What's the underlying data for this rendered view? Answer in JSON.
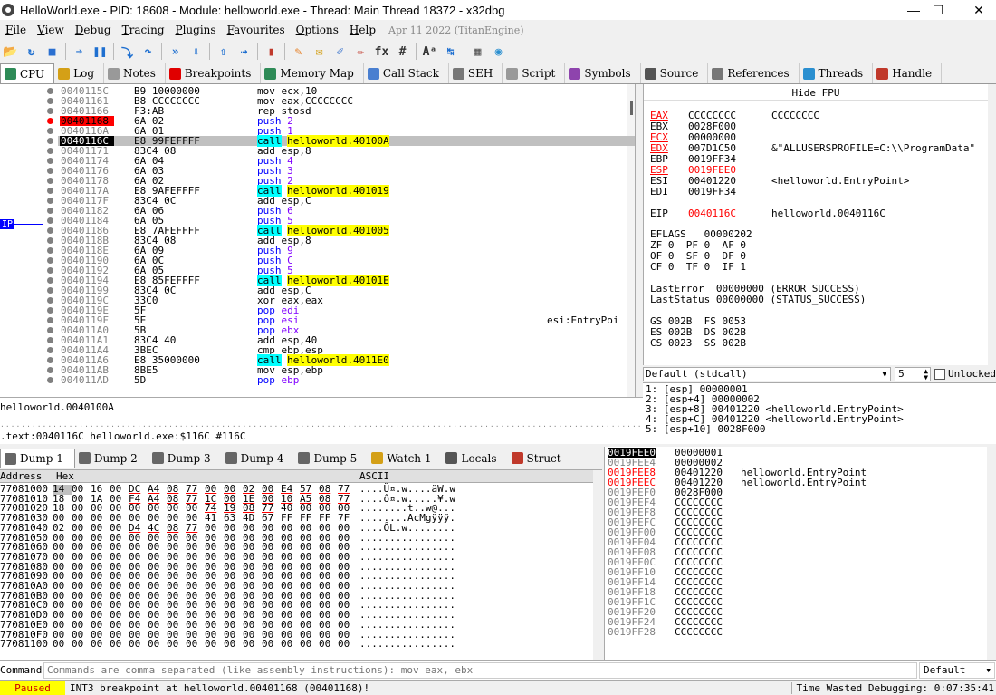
{
  "window": {
    "title": "HelloWorld.exe - PID: 18608 - Module: helloworld.exe - Thread: Main Thread 18372 - x32dbg",
    "minimize": "—",
    "maximize": "☐",
    "close": "✕"
  },
  "menu": {
    "items": [
      {
        "u": "F",
        "rest": "ile"
      },
      {
        "u": "V",
        "rest": "iew"
      },
      {
        "u": "D",
        "rest": "ebug"
      },
      {
        "u": "T",
        "rest": "racing"
      },
      {
        "u": "P",
        "rest": "lugins"
      },
      {
        "u": "F",
        "rest": "avourites"
      },
      {
        "u": "O",
        "rest": "ptions"
      },
      {
        "u": "H",
        "rest": "elp"
      }
    ],
    "date": "Apr 11 2022 (TitanEngine)"
  },
  "toolbar": [
    {
      "name": "open-icon",
      "glyph": "📂",
      "color": "#d4a017"
    },
    {
      "name": "restart-icon",
      "glyph": "↻",
      "color": "#1e6fd0"
    },
    {
      "name": "stop-icon",
      "glyph": "■",
      "color": "#2a6fd0"
    },
    {
      "sep": true
    },
    {
      "name": "run-icon",
      "glyph": "➔",
      "color": "#1e6fd0"
    },
    {
      "name": "pause-icon",
      "glyph": "❚❚",
      "color": "#1e6fd0"
    },
    {
      "sep": true
    },
    {
      "name": "step-into-icon",
      "glyph": "⤵",
      "color": "#1e6fd0"
    },
    {
      "name": "step-over-icon",
      "glyph": "↷",
      "color": "#1e6fd0"
    },
    {
      "sep": true
    },
    {
      "name": "trace-into-icon",
      "glyph": "»",
      "color": "#1e6fd0"
    },
    {
      "name": "trace-over-icon",
      "glyph": "⇩",
      "color": "#1e6fd0"
    },
    {
      "sep": true
    },
    {
      "name": "execute-till-return-icon",
      "glyph": "⇧",
      "color": "#1e6fd0"
    },
    {
      "name": "run-to-user-code-icon",
      "glyph": "⇢",
      "color": "#1e6fd0"
    },
    {
      "sep": true
    },
    {
      "name": "scylla-icon",
      "glyph": "▮",
      "color": "#c0392b"
    },
    {
      "sep": true
    },
    {
      "name": "patch-icon",
      "glyph": "✎",
      "color": "#e67e22"
    },
    {
      "name": "comment-icon",
      "glyph": "✉",
      "color": "#d4a017"
    },
    {
      "name": "label-icon",
      "glyph": "✐",
      "color": "#4a7fd0"
    },
    {
      "name": "bookmark-icon",
      "glyph": "✏",
      "color": "#c0392b"
    },
    {
      "name": "function-icon",
      "glyph": "fx",
      "color": "#333"
    },
    {
      "name": "hash-icon",
      "glyph": "#",
      "color": "#333"
    },
    {
      "sep": true
    },
    {
      "name": "font-icon",
      "glyph": "Aᵃ",
      "color": "#333"
    },
    {
      "name": "strings-icon",
      "glyph": "↹",
      "color": "#1e6fd0"
    },
    {
      "sep": true
    },
    {
      "name": "calculator-icon",
      "glyph": "▦",
      "color": "#555"
    },
    {
      "name": "globe-icon",
      "glyph": "◉",
      "color": "#2a8fd0"
    }
  ],
  "tabs": [
    {
      "name": "tab-cpu",
      "label": "CPU",
      "icon": "cpu-icon",
      "color": "#2e8b57",
      "active": true
    },
    {
      "name": "tab-log",
      "label": "Log",
      "icon": "log-icon",
      "color": "#d4a017"
    },
    {
      "name": "tab-notes",
      "label": "Notes",
      "icon": "notes-icon",
      "color": "#999"
    },
    {
      "name": "tab-breakpoints",
      "label": "Breakpoints",
      "icon": "breakpoint-icon",
      "color": "#e00000"
    },
    {
      "name": "tab-memory-map",
      "label": "Memory Map",
      "icon": "memory-map-icon",
      "color": "#2e8b57"
    },
    {
      "name": "tab-call-stack",
      "label": "Call Stack",
      "icon": "call-stack-icon",
      "color": "#4a7fd0"
    },
    {
      "name": "tab-seh",
      "label": "SEH",
      "icon": "seh-icon",
      "color": "#777"
    },
    {
      "name": "tab-script",
      "label": "Script",
      "icon": "script-icon",
      "color": "#999"
    },
    {
      "name": "tab-symbols",
      "label": "Symbols",
      "icon": "symbols-icon",
      "color": "#8e44ad"
    },
    {
      "name": "tab-source",
      "label": "Source",
      "icon": "source-icon",
      "color": "#555"
    },
    {
      "name": "tab-references",
      "label": "References",
      "icon": "references-icon",
      "color": "#777"
    },
    {
      "name": "tab-threads",
      "label": "Threads",
      "icon": "threads-icon",
      "color": "#2a8fd0"
    },
    {
      "name": "tab-handles",
      "label": "Handle",
      "icon": "handles-icon",
      "color": "#c0392b"
    }
  ],
  "disasm": [
    {
      "addr": "0040115C",
      "bytes": "B9 10000000",
      "mn": "mov",
      "op": " ecx,10",
      "kind": "def"
    },
    {
      "addr": "00401161",
      "bytes": "B8 CCCCCCCC",
      "mn": "mov",
      "op": " eax,CCCCCCCC",
      "kind": "def"
    },
    {
      "addr": "00401166",
      "bytes": "F3:AB",
      "mn": "rep stosd",
      "op": "",
      "kind": "def"
    },
    {
      "addr": "00401168",
      "bytes": "6A 02",
      "mn": "push",
      "op": " 2",
      "kind": "push",
      "bp": true
    },
    {
      "addr": "0040116A",
      "bytes": "6A 01",
      "mn": "push",
      "op": " 1",
      "kind": "push"
    },
    {
      "addr": "0040116C",
      "bytes": "E8 99FEFFFF",
      "mn": "call",
      "op": "helloworld.40100A",
      "kind": "call",
      "ip": true
    },
    {
      "addr": "00401171",
      "bytes": "83C4 08",
      "mn": "add",
      "op": " esp,8",
      "kind": "def"
    },
    {
      "addr": "00401174",
      "bytes": "6A 04",
      "mn": "push",
      "op": " 4",
      "kind": "push"
    },
    {
      "addr": "00401176",
      "bytes": "6A 03",
      "mn": "push",
      "op": " 3",
      "kind": "push"
    },
    {
      "addr": "00401178",
      "bytes": "6A 02",
      "mn": "push",
      "op": " 2",
      "kind": "push"
    },
    {
      "addr": "0040117A",
      "bytes": "E8 9AFEFFFF",
      "mn": "call",
      "op": "helloworld.401019",
      "kind": "call"
    },
    {
      "addr": "0040117F",
      "bytes": "83C4 0C",
      "mn": "add",
      "op": " esp,C",
      "kind": "def"
    },
    {
      "addr": "00401182",
      "bytes": "6A 06",
      "mn": "push",
      "op": " 6",
      "kind": "push"
    },
    {
      "addr": "00401184",
      "bytes": "6A 05",
      "mn": "push",
      "op": " 5",
      "kind": "push"
    },
    {
      "addr": "00401186",
      "bytes": "E8 7AFEFFFF",
      "mn": "call",
      "op": "helloworld.401005",
      "kind": "call"
    },
    {
      "addr": "0040118B",
      "bytes": "83C4 08",
      "mn": "add",
      "op": " esp,8",
      "kind": "def"
    },
    {
      "addr": "0040118E",
      "bytes": "6A 09",
      "mn": "push",
      "op": " 9",
      "kind": "push"
    },
    {
      "addr": "00401190",
      "bytes": "6A 0C",
      "mn": "push",
      "op": " C",
      "kind": "push"
    },
    {
      "addr": "00401192",
      "bytes": "6A 05",
      "mn": "push",
      "op": " 5",
      "kind": "push"
    },
    {
      "addr": "00401194",
      "bytes": "E8 85FEFFFF",
      "mn": "call",
      "op": "helloworld.40101E",
      "kind": "call"
    },
    {
      "addr": "00401199",
      "bytes": "83C4 0C",
      "mn": "add",
      "op": " esp,C",
      "kind": "def"
    },
    {
      "addr": "0040119C",
      "bytes": "33C0",
      "mn": "xor",
      "op": " eax,eax",
      "kind": "def"
    },
    {
      "addr": "0040119E",
      "bytes": "5F",
      "mn": "pop",
      "op": " edi",
      "kind": "push"
    },
    {
      "addr": "0040119F",
      "bytes": "5E",
      "mn": "pop",
      "op": " esi",
      "kind": "push",
      "cmt": "esi:EntryPoi"
    },
    {
      "addr": "004011A0",
      "bytes": "5B",
      "mn": "pop",
      "op": " ebx",
      "kind": "push"
    },
    {
      "addr": "004011A1",
      "bytes": "83C4 40",
      "mn": "add",
      "op": " esp,40",
      "kind": "def"
    },
    {
      "addr": "004011A4",
      "bytes": "3BEC",
      "mn": "cmp",
      "op": " ebp,esp",
      "kind": "def"
    },
    {
      "addr": "004011A6",
      "bytes": "E8 35000000",
      "mn": "call",
      "op": "helloworld.4011E0",
      "kind": "call"
    },
    {
      "addr": "004011AB",
      "bytes": "8BE5",
      "mn": "mov",
      "op": " esp,ebp",
      "kind": "def"
    },
    {
      "addr": "004011AD",
      "bytes": "5D",
      "mn": "pop",
      "op": " ebp",
      "kind": "push"
    }
  ],
  "ip_label": "IP",
  "info1": "helloworld.0040100A",
  "info_dots": "...........................................................................................................................................................................",
  "info2": ".text:0040116C helloworld.exe:$116C #116C",
  "fpu_title": "Hide FPU",
  "registers": [
    {
      "n": "EAX",
      "v": "CCCCCCCC",
      "c": "CCCCCCCC",
      "chg_n": true,
      "chg_v": false
    },
    {
      "n": "EBX",
      "v": "0028F000",
      "c": ""
    },
    {
      "n": "ECX",
      "v": "00000000",
      "c": "",
      "chg_n": true
    },
    {
      "n": "EDX",
      "v": "007D1C50",
      "c": "&\"ALLUSERSPROFILE=C:\\\\ProgramData\"",
      "chg_n": true
    },
    {
      "n": "EBP",
      "v": "0019FF34",
      "c": ""
    },
    {
      "n": "ESP",
      "v": "0019FEE0",
      "c": "",
      "chg_n": true,
      "chg_v": true
    },
    {
      "n": "ESI",
      "v": "00401220",
      "c": "<helloworld.EntryPoint>"
    },
    {
      "n": "EDI",
      "v": "0019FF34",
      "c": ""
    },
    {
      "n": "",
      "v": "",
      "c": ""
    },
    {
      "n": "EIP",
      "v": "0040116C",
      "c": "helloworld.0040116C",
      "chg_v": true
    }
  ],
  "flags": {
    "eflags": "EFLAGS   00000202",
    "row1": "ZF 0  PF 0  AF 0",
    "row2": "OF 0  SF 0  DF 0",
    "row3": "CF 0  TF 0  IF 1",
    "last_error": "LastError  00000000 (ERROR_SUCCESS)",
    "last_status": "LastStatus 00000000 (STATUS_SUCCESS)",
    "seg1": "GS 002B  FS 0053",
    "seg2": "ES 002B  DS 002B",
    "seg3": "CS 0023  SS 002B"
  },
  "callconv": {
    "selected": "Default (stdcall)",
    "count": "5",
    "unlocked": "Unlocked"
  },
  "args": [
    "1: [esp] 00000001",
    "2: [esp+4] 00000002",
    "3: [esp+8] 00401220 <helloworld.EntryPoint>",
    "4: [esp+C] 00401220 <helloworld.EntryPoint>",
    "5: [esp+10] 0028F000"
  ],
  "dump_tabs": [
    {
      "name": "tab-dump-1",
      "label": "Dump 1",
      "active": true
    },
    {
      "name": "tab-dump-2",
      "label": "Dump 2"
    },
    {
      "name": "tab-dump-3",
      "label": "Dump 3"
    },
    {
      "name": "tab-dump-4",
      "label": "Dump 4"
    },
    {
      "name": "tab-dump-5",
      "label": "Dump 5"
    },
    {
      "name": "tab-watch-1",
      "label": "Watch 1"
    },
    {
      "name": "tab-locals",
      "label": "Locals"
    },
    {
      "name": "tab-struct",
      "label": "Struct"
    }
  ],
  "dump_headers": {
    "address": "Address",
    "hex": "Hex",
    "ascii": "ASCII"
  },
  "dump_rows": [
    {
      "a": "77081000",
      "h": [
        "14",
        "00",
        "16",
        "00",
        "DC",
        "A4",
        "08",
        "77",
        "00",
        "00",
        "02",
        "00",
        "E4",
        "57",
        "08",
        "77"
      ],
      "s": "....Ü¤.w....äW.w"
    },
    {
      "a": "77081010",
      "h": [
        "18",
        "00",
        "1A",
        "00",
        "F4",
        "A4",
        "08",
        "77",
        "1C",
        "00",
        "1E",
        "00",
        "10",
        "A5",
        "08",
        "77"
      ],
      "s": "....ô¤.w.....¥.w"
    },
    {
      "a": "77081020",
      "h": [
        "18",
        "00",
        "00",
        "00",
        "00",
        "00",
        "00",
        "00",
        "74",
        "19",
        "08",
        "77",
        "40",
        "00",
        "00",
        "00"
      ],
      "s": "........t..w@..."
    },
    {
      "a": "77081030",
      "h": [
        "00",
        "00",
        "00",
        "00",
        "00",
        "00",
        "00",
        "00",
        "41",
        "63",
        "4D",
        "67",
        "FF",
        "FF",
        "FF",
        "7F"
      ],
      "s": "........AcMgÿÿÿ."
    },
    {
      "a": "77081040",
      "h": [
        "02",
        "00",
        "00",
        "00",
        "D4",
        "4C",
        "08",
        "77",
        "00",
        "00",
        "00",
        "00",
        "00",
        "00",
        "00",
        "00"
      ],
      "s": "....ÔL.w........"
    },
    {
      "a": "77081050",
      "h": [
        "00",
        "00",
        "00",
        "00",
        "00",
        "00",
        "00",
        "00",
        "00",
        "00",
        "00",
        "00",
        "00",
        "00",
        "00",
        "00"
      ],
      "s": "................"
    },
    {
      "a": "77081060",
      "h": [
        "00",
        "00",
        "00",
        "00",
        "00",
        "00",
        "00",
        "00",
        "00",
        "00",
        "00",
        "00",
        "00",
        "00",
        "00",
        "00"
      ],
      "s": "................"
    },
    {
      "a": "77081070",
      "h": [
        "00",
        "00",
        "00",
        "00",
        "00",
        "00",
        "00",
        "00",
        "00",
        "00",
        "00",
        "00",
        "00",
        "00",
        "00",
        "00"
      ],
      "s": "................"
    },
    {
      "a": "77081080",
      "h": [
        "00",
        "00",
        "00",
        "00",
        "00",
        "00",
        "00",
        "00",
        "00",
        "00",
        "00",
        "00",
        "00",
        "00",
        "00",
        "00"
      ],
      "s": "................"
    },
    {
      "a": "77081090",
      "h": [
        "00",
        "00",
        "00",
        "00",
        "00",
        "00",
        "00",
        "00",
        "00",
        "00",
        "00",
        "00",
        "00",
        "00",
        "00",
        "00"
      ],
      "s": "................"
    },
    {
      "a": "770810A0",
      "h": [
        "00",
        "00",
        "00",
        "00",
        "00",
        "00",
        "00",
        "00",
        "00",
        "00",
        "00",
        "00",
        "00",
        "00",
        "00",
        "00"
      ],
      "s": "................"
    },
    {
      "a": "770810B0",
      "h": [
        "00",
        "00",
        "00",
        "00",
        "00",
        "00",
        "00",
        "00",
        "00",
        "00",
        "00",
        "00",
        "00",
        "00",
        "00",
        "00"
      ],
      "s": "................"
    },
    {
      "a": "770810C0",
      "h": [
        "00",
        "00",
        "00",
        "00",
        "00",
        "00",
        "00",
        "00",
        "00",
        "00",
        "00",
        "00",
        "00",
        "00",
        "00",
        "00"
      ],
      "s": "................"
    },
    {
      "a": "770810D0",
      "h": [
        "00",
        "00",
        "00",
        "00",
        "00",
        "00",
        "00",
        "00",
        "00",
        "00",
        "00",
        "00",
        "00",
        "00",
        "00",
        "00"
      ],
      "s": "................"
    },
    {
      "a": "770810E0",
      "h": [
        "00",
        "00",
        "00",
        "00",
        "00",
        "00",
        "00",
        "00",
        "00",
        "00",
        "00",
        "00",
        "00",
        "00",
        "00",
        "00"
      ],
      "s": "................"
    },
    {
      "a": "770810F0",
      "h": [
        "00",
        "00",
        "00",
        "00",
        "00",
        "00",
        "00",
        "00",
        "00",
        "00",
        "00",
        "00",
        "00",
        "00",
        "00",
        "00"
      ],
      "s": "................"
    },
    {
      "a": "77081100",
      "h": [
        "00",
        "00",
        "00",
        "00",
        "00",
        "00",
        "00",
        "00",
        "00",
        "00",
        "00",
        "00",
        "00",
        "00",
        "00",
        "00"
      ],
      "s": "................"
    }
  ],
  "stack_rows": [
    {
      "a": "0019FEE0",
      "v": "00000001",
      "c": "",
      "top": true
    },
    {
      "a": "0019FEE4",
      "v": "00000002",
      "c": ""
    },
    {
      "a": "0019FEE8",
      "v": "00401220",
      "c": "helloworld.EntryPoint",
      "red": true
    },
    {
      "a": "0019FEEC",
      "v": "00401220",
      "c": "helloworld.EntryPoint",
      "red": true
    },
    {
      "a": "0019FEF0",
      "v": "0028F000",
      "c": ""
    },
    {
      "a": "0019FEF4",
      "v": "CCCCCCCC",
      "c": ""
    },
    {
      "a": "0019FEF8",
      "v": "CCCCCCCC",
      "c": ""
    },
    {
      "a": "0019FEFC",
      "v": "CCCCCCCC",
      "c": ""
    },
    {
      "a": "0019FF00",
      "v": "CCCCCCCC",
      "c": ""
    },
    {
      "a": "0019FF04",
      "v": "CCCCCCCC",
      "c": ""
    },
    {
      "a": "0019FF08",
      "v": "CCCCCCCC",
      "c": ""
    },
    {
      "a": "0019FF0C",
      "v": "CCCCCCCC",
      "c": ""
    },
    {
      "a": "0019FF10",
      "v": "CCCCCCCC",
      "c": ""
    },
    {
      "a": "0019FF14",
      "v": "CCCCCCCC",
      "c": ""
    },
    {
      "a": "0019FF18",
      "v": "CCCCCCCC",
      "c": ""
    },
    {
      "a": "0019FF1C",
      "v": "CCCCCCCC",
      "c": ""
    },
    {
      "a": "0019FF20",
      "v": "CCCCCCCC",
      "c": ""
    },
    {
      "a": "0019FF24",
      "v": "CCCCCCCC",
      "c": ""
    },
    {
      "a": "0019FF28",
      "v": "CCCCCCCC",
      "c": ""
    }
  ],
  "command": {
    "label": "Command:",
    "placeholder": "Commands are comma separated (like assembly instructions): mov eax, ebx",
    "mode": "Default"
  },
  "status": {
    "state": "Paused",
    "message": "INT3 breakpoint at helloworld.00401168 (00401168)!",
    "time": "Time Wasted Debugging: 0:07:35:41"
  }
}
